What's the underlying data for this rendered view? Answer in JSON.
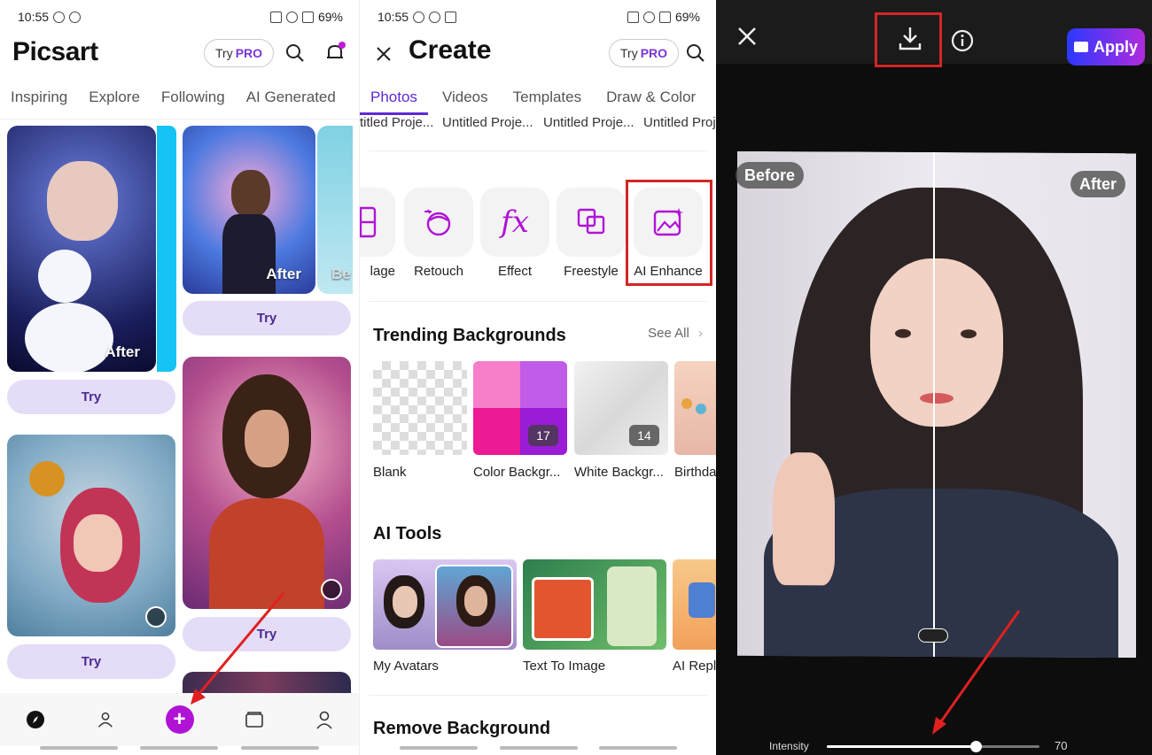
{
  "feed": {
    "status": {
      "time": "10:55",
      "battery": "69%"
    },
    "logo": "Picsart",
    "try_label": "Try",
    "pro_label": "PRO",
    "tabs": [
      "Inspiring",
      "Explore",
      "Following",
      "AI Generated"
    ],
    "cards": [
      {
        "badge": "After",
        "try": "Try"
      },
      {
        "badge": "After",
        "try": "Try"
      },
      {
        "try": "Try"
      },
      {
        "try": "Try"
      }
    ],
    "cut_badge": "Be"
  },
  "create": {
    "status": {
      "time": "10:55",
      "battery": "69%"
    },
    "title": "Create",
    "try_label": "Try",
    "pro_label": "PRO",
    "tabs": [
      "Photos",
      "Videos",
      "Templates",
      "Draw & Color"
    ],
    "projects": [
      "titled Proje...",
      "Untitled Proje...",
      "Untitled Proje...",
      "Untitled Proj"
    ],
    "tools": [
      {
        "label": "lage",
        "icon": "collage-icon"
      },
      {
        "label": "Retouch",
        "icon": "retouch-icon"
      },
      {
        "label": "Effect",
        "icon": "effect-fx-icon"
      },
      {
        "label": "Freestyle",
        "icon": "freestyle-icon"
      },
      {
        "label": "AI Enhance",
        "icon": "ai-enhance-icon"
      }
    ],
    "trending_title": "Trending Backgrounds",
    "see_all": "See All",
    "backgrounds": [
      {
        "label": "Blank"
      },
      {
        "label": "Color Backgr...",
        "count": "17"
      },
      {
        "label": "White Backgr...",
        "count": "14"
      },
      {
        "label": "Birthda"
      }
    ],
    "ai_tools_title": "AI Tools",
    "ai_tools": [
      "My Avatars",
      "Text To Image",
      "AI Repla"
    ],
    "remove_bg_title": "Remove Background"
  },
  "enhance": {
    "apply": "Apply",
    "before": "Before",
    "after": "After",
    "intensity_label": "Intensity",
    "intensity_value": "70",
    "intensity_fraction": 0.7
  },
  "colors": {
    "accent": "#5b2bd6",
    "plus": "#b013d6",
    "highlight": "#d32626"
  }
}
